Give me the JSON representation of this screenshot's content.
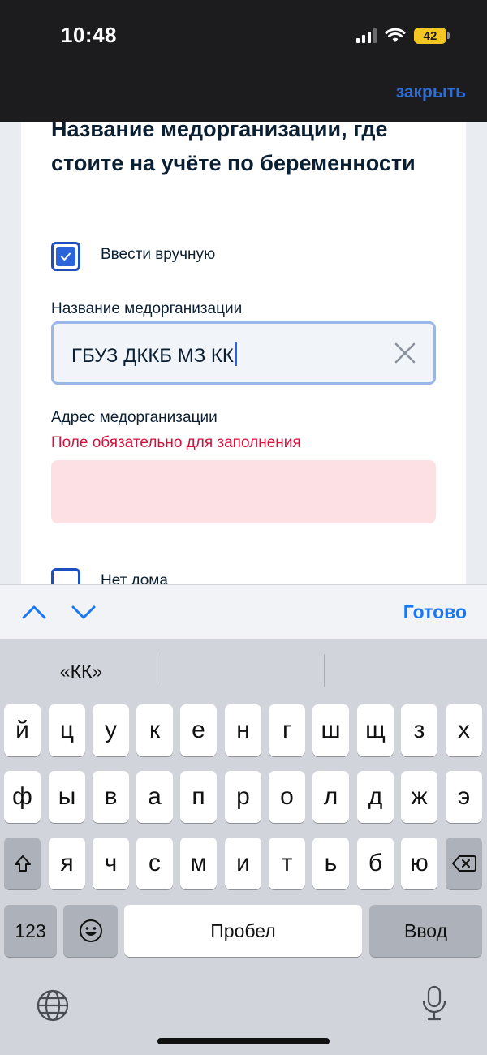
{
  "status": {
    "time": "10:48",
    "battery": "42"
  },
  "header": {
    "close_label": "закрыть"
  },
  "form": {
    "title": "Название медорганизации, где стоите на учёте по беременности",
    "manual_checkbox_label": "Ввести вручную",
    "org_name_label": "Название медорганизации",
    "org_name_value": "ГБУЗ ДККБ МЗ КК",
    "address_label": "Адрес медорганизации",
    "address_error": "Поле обязательно для заполнения",
    "no_house_label": "Нет дома"
  },
  "toolbar": {
    "done_label": "Готово"
  },
  "keyboard": {
    "suggestions": [
      "«КК»",
      "",
      ""
    ],
    "row1": [
      "й",
      "ц",
      "у",
      "к",
      "е",
      "н",
      "г",
      "ш",
      "щ",
      "з",
      "х"
    ],
    "row2": [
      "ф",
      "ы",
      "в",
      "а",
      "п",
      "р",
      "о",
      "л",
      "д",
      "ж",
      "э"
    ],
    "row3": [
      "я",
      "ч",
      "с",
      "м",
      "и",
      "т",
      "ь",
      "б",
      "ю"
    ],
    "numbers_label": "123",
    "space_label": "Пробел",
    "return_label": "Ввод"
  },
  "icons": {
    "signal": "cellular-signal-icon",
    "wifi": "wifi-icon",
    "clear": "clear-x-icon",
    "up": "chevron-up-icon",
    "down": "chevron-down-icon",
    "emoji": "emoji-icon",
    "globe": "globe-icon",
    "mic": "microphone-icon",
    "shift": "shift-icon",
    "backspace": "backspace-icon"
  },
  "colors": {
    "accent": "#2b64d9",
    "error": "#d2123d",
    "error_bg": "#fde0e3"
  }
}
